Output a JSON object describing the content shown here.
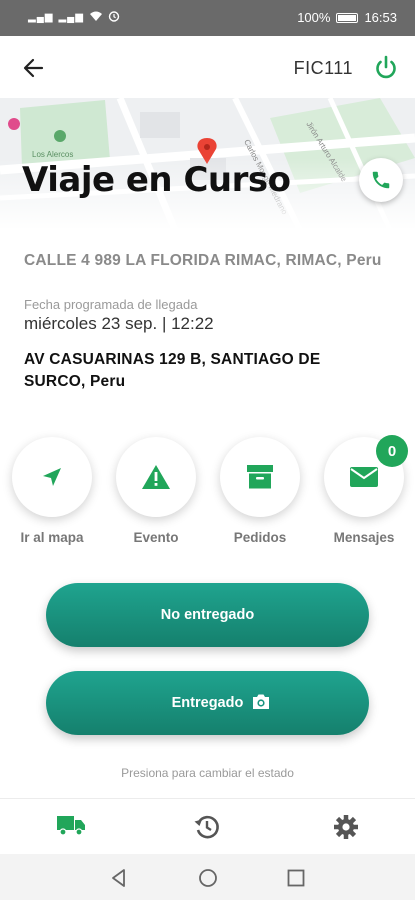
{
  "status_bar": {
    "battery": "100%",
    "time": "16:53"
  },
  "header": {
    "code": "FIC111",
    "back_icon": "arrow-left-icon",
    "power_icon": "power-icon"
  },
  "map": {
    "labels": [
      "Los Alercos",
      "Carlos Monge Medrano",
      "Jirón Arturo Alcalde"
    ]
  },
  "trip": {
    "title": "Viaje en Curso",
    "origin": "CALLE 4 989 LA FLORIDA RIMAC, RIMAC, Peru",
    "eta_label": "Fecha programada de llegada",
    "eta_value": "miércoles 23 sep. | 12:22",
    "destination": "AV CASUARINAS 129 B, SANTIAGO DE SURCO, Peru"
  },
  "actions": [
    {
      "label": "Ir al mapa",
      "icon": "navigation-arrow-icon"
    },
    {
      "label": "Evento",
      "icon": "warning-icon"
    },
    {
      "label": "Pedidos",
      "icon": "archive-box-icon"
    },
    {
      "label": "Mensajes",
      "icon": "envelope-icon",
      "badge": "0"
    }
  ],
  "buttons": {
    "not_delivered": "No entregado",
    "delivered": "Entregado",
    "hint": "Presiona para cambiar el estado"
  },
  "bottom_nav": [
    {
      "icon": "truck-icon",
      "active": true
    },
    {
      "icon": "history-icon",
      "active": false
    },
    {
      "icon": "gear-icon",
      "active": false
    }
  ],
  "colors": {
    "accent": "#21a65a",
    "button": "#1a9480",
    "text_muted": "#8a8a8a"
  }
}
